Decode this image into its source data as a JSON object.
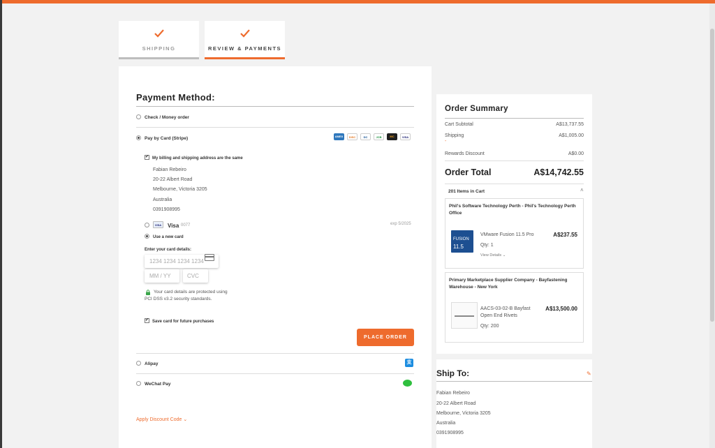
{
  "colors": {
    "accent": "#ee6b2d"
  },
  "steps": [
    {
      "label": "SHIPPING",
      "icon": "check-icon"
    },
    {
      "label": "REVIEW & PAYMENTS",
      "icon": "check-icon"
    }
  ],
  "payment": {
    "title": "Payment Method:",
    "options": {
      "checkmo": "Check / Money order",
      "stripe": "Pay by Card (Stripe)",
      "alipay": "Alipay",
      "wechat": "WeChat Pay"
    },
    "card_logos": [
      "AMEX",
      "DISC",
      "DC",
      "JCB",
      "MC",
      "VISA"
    ],
    "billing_same_label": "My billing and shipping address are the same",
    "billing": [
      "Fabian Rebeiro",
      "20-22 Albert Road",
      "Melbourne, Victoria 3205",
      "Australia",
      "0391908995"
    ],
    "saved_card": {
      "brand": "Visa",
      "last4": "0077",
      "exp": "exp 5/2025"
    },
    "new_card_label": "Use a new card",
    "enter_details": "Enter your card details:",
    "card_number_placeholder": "1234 1234 1234 1234",
    "expiry_placeholder": "MM / YY",
    "cvc_placeholder": "CVC",
    "secure_note_1": "Your card details are protected using",
    "secure_note_2": "PCI DSS v3.2 security standards.",
    "save_card_label": "Save card for future purchases",
    "place_order": "PLACE ORDER",
    "discount_link": "Apply Discount Code"
  },
  "summary": {
    "title": "Order Summary",
    "subtotal_label": "Cart Subtotal",
    "subtotal": "A$13,737.55",
    "shipping_label": "Shipping",
    "shipping": "A$1,005.00",
    "shipping_sub": "-",
    "rewards_label": "Rewards Discount",
    "rewards": "A$0.00",
    "total_label": "Order Total",
    "total": "A$14,742.55",
    "items_count": "201 Items in Cart",
    "vendors": [
      {
        "name": "Phil's Software Technology Perth - Phil's Technology Perth Office",
        "product": "VMware Fusion 11.5 Pro",
        "price": "A$237.55",
        "qty": "Qty:  1",
        "details": "View Details",
        "img_text": "FUSION",
        "img_ver": "11.5"
      },
      {
        "name": "Primary Marketplace Supplier Company - Bayfastening Warehouse - New York",
        "product_1": "AACS-03-02-B Bayfast",
        "product_2": "Open End Rivets",
        "price": "A$13,500.00",
        "qty": "Qty:  200"
      }
    ]
  },
  "ship_to": {
    "title": "Ship To:",
    "lines": [
      "Fabian Rebeiro",
      "20-22 Albert Road",
      "Melbourne, Victoria 3205",
      "Australia",
      "0391908995"
    ]
  }
}
